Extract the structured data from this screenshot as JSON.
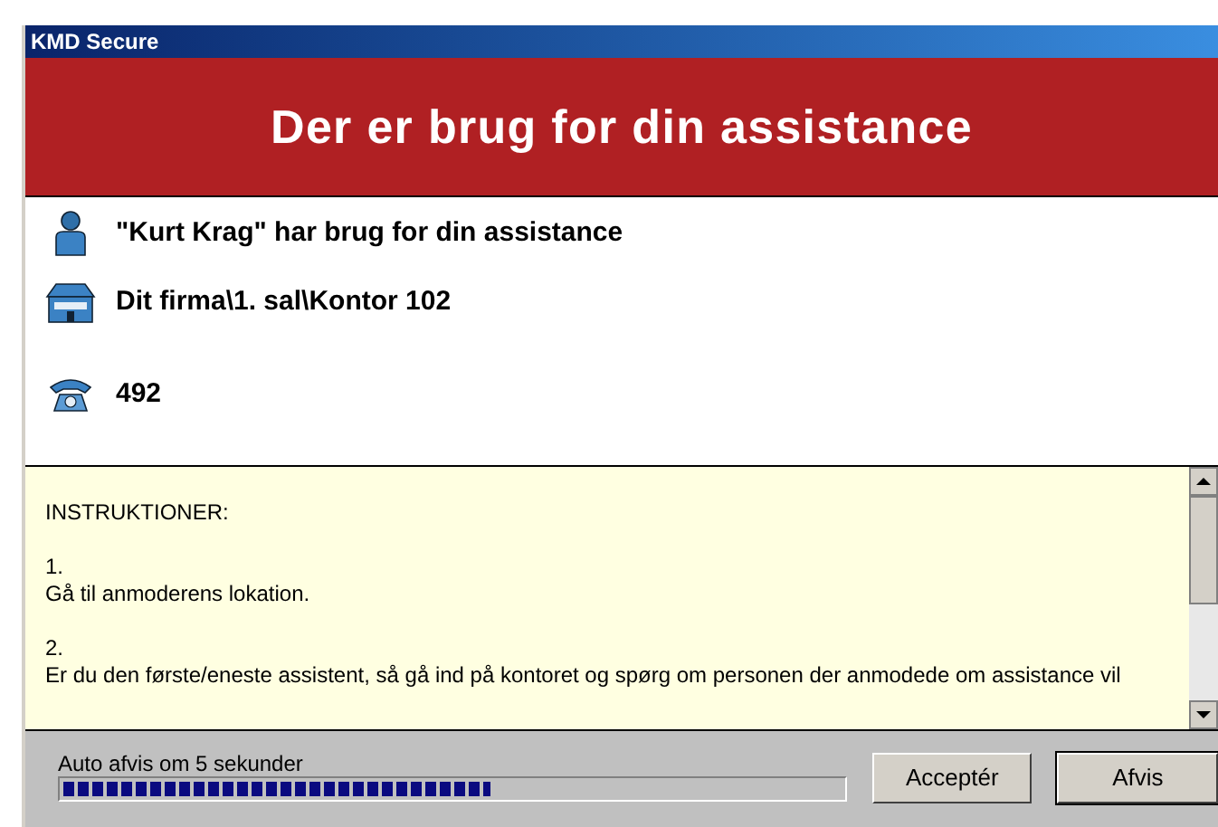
{
  "window": {
    "title": "KMD Secure"
  },
  "banner": {
    "title": "Der er brug for din assistance"
  },
  "info": [
    {
      "kind": "person",
      "text": "\"Kurt Krag\" har brug for din assistance"
    },
    {
      "kind": "building",
      "text": "Dit firma\\1. sal\\Kontor 102"
    },
    {
      "kind": "phone",
      "text": "492"
    }
  ],
  "instructions": [
    {
      "kind": "heading",
      "text": "INSTRUKTIONER:"
    },
    {
      "kind": "step",
      "number": "1.",
      "text": "Gå til anmoderens lokation."
    },
    {
      "kind": "step",
      "number": "2.",
      "text": "Er du den første/eneste assistent, så gå ind på kontoret og spørg om personen der anmodede om assistance vil"
    }
  ],
  "footer": {
    "countdown": "Auto afvis om 5 sekunder",
    "level": 0.55,
    "buttons": [
      "Acceptér",
      "Afvis"
    ]
  }
}
